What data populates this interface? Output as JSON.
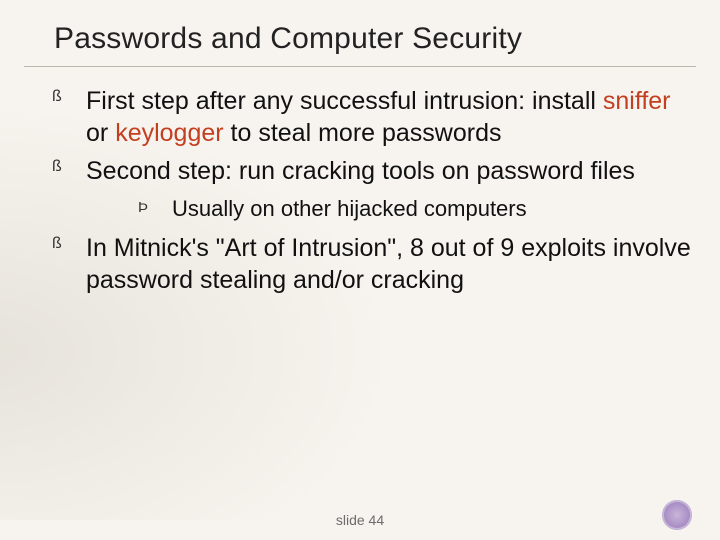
{
  "title": "Passwords and Computer Security",
  "bullets": {
    "b1_pre": "First step after any successful intrusion: install ",
    "b1_kw1": "sniffer",
    "b1_mid": " or ",
    "b1_kw2": "keylogger",
    "b1_post": " to steal more passwords",
    "b2": "Second step: run cracking tools on password files",
    "b2_sub1": "Usually on other hijacked computers",
    "b3": "In Mitnick's \"Art of Intrusion\", 8 out of 9 exploits involve password stealing and/or cracking"
  },
  "footer": "slide 44",
  "colors": {
    "keyword": "#c23f1f",
    "background": "#f7f4ef",
    "text": "#111111"
  }
}
